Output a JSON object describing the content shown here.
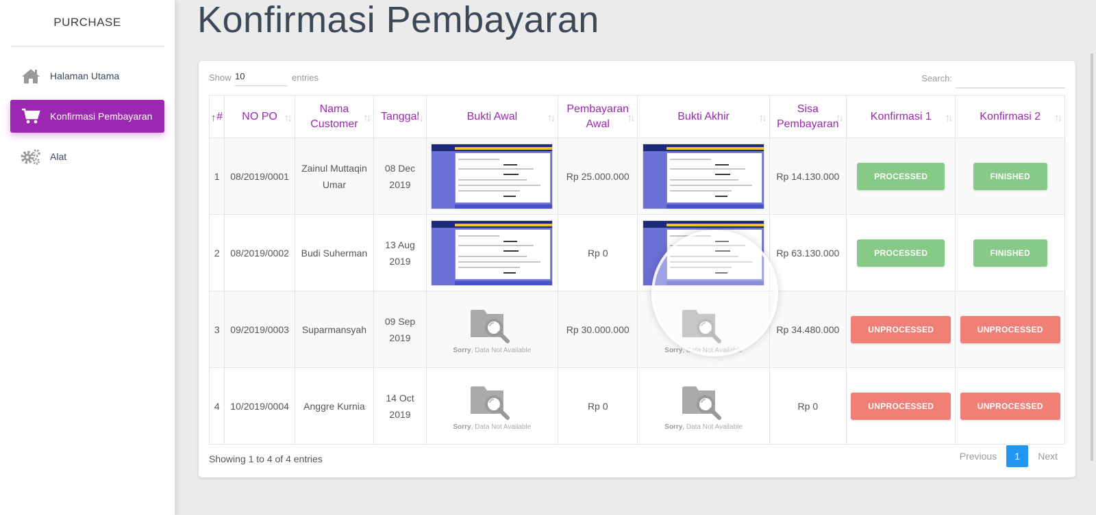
{
  "sidebar": {
    "brand": "PURCHASE",
    "items": [
      {
        "label": "Halaman Utama",
        "icon": "home-icon",
        "active": false
      },
      {
        "label": "Konfirmasi Pembayaran",
        "icon": "cart-icon",
        "active": true
      },
      {
        "label": "Alat",
        "icon": "gears-icon",
        "active": false
      }
    ]
  },
  "page": {
    "title": "Konfirmasi Pembayaran"
  },
  "table_controls": {
    "show_label": "Show",
    "entries_value": "10",
    "entries_label": "entries",
    "search_label": "Search:",
    "search_value": ""
  },
  "table": {
    "columns": [
      "#",
      "NO PO",
      "Nama Customer",
      "Tanggal",
      "Bukti Awal",
      "Pembayaran Awal",
      "Bukti Akhir",
      "Sisa Pembayaran",
      "Konfirmasi 1",
      "Konfirmasi 2"
    ],
    "rows": [
      {
        "no": "1",
        "po": "08/2019/0001",
        "customer": "Zainul Muttaqin Umar",
        "date": "08 Dec 2019",
        "bukti_awal": "image",
        "awal": "Rp 25.000.000",
        "bukti_akhir": "image",
        "sisa": "Rp 14.130.000",
        "k1": "PROCESSED",
        "k2": "FINISHED"
      },
      {
        "no": "2",
        "po": "08/2019/0002",
        "customer": "Budi Suherman",
        "date": "13 Aug 2019",
        "bukti_awal": "image",
        "awal": "Rp 0",
        "bukti_akhir": "image",
        "sisa": "Rp 63.130.000",
        "k1": "PROCESSED",
        "k2": "FINISHED"
      },
      {
        "no": "3",
        "po": "09/2019/0003",
        "customer": "Suparmansyah",
        "date": "09 Sep 2019",
        "bukti_awal": "none",
        "awal": "Rp 30.000.000",
        "bukti_akhir": "none",
        "sisa": "Rp 34.480.000",
        "k1": "UNPROCESSED",
        "k2": "UNPROCESSED"
      },
      {
        "no": "4",
        "po": "10/2019/0004",
        "customer": "Anggre Kurnia",
        "date": "14 Oct 2019",
        "bukti_awal": "none",
        "awal": "Rp 0",
        "bukti_akhir": "none",
        "sisa": "Rp 0",
        "k1": "UNPROCESSED",
        "k2": "UNPROCESSED"
      }
    ],
    "not_available": {
      "strong": "Sorry",
      "rest": ", Data Not Available"
    }
  },
  "footer": {
    "info": "Showing 1 to 4 of 4 entries",
    "previous": "Previous",
    "page": "1",
    "next": "Next"
  },
  "colors": {
    "accent": "#9c27b0",
    "processed": "#87c987",
    "unprocessed": "#f07f77",
    "pager_active": "#2196f3"
  }
}
